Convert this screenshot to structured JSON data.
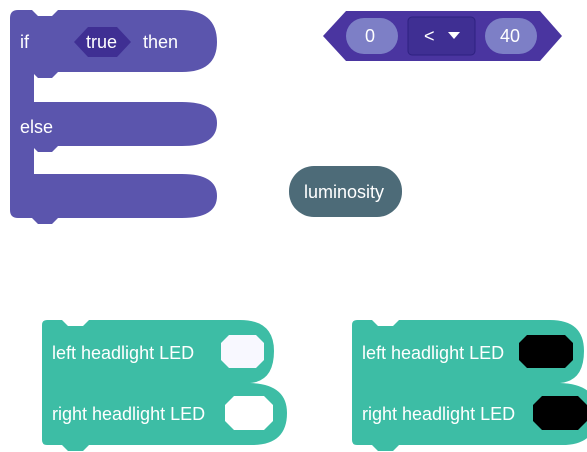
{
  "if_else_block": {
    "if_label": "if",
    "condition_value": "true",
    "then_label": "then",
    "else_label": "else",
    "color": "#5b55ad",
    "condition_color": "#3f2f93"
  },
  "compare_block": {
    "left_value": "0",
    "operator": "<",
    "right_value": "40",
    "color": "#4a35a0",
    "slot_color": "#7d7fc6"
  },
  "sensor_block": {
    "label": "luminosity",
    "color": "#4d6b78"
  },
  "led_block_left": {
    "row1_label": "left headlight LED",
    "row2_label": "right headlight LED",
    "color": "#3dbda5",
    "led_colors": [
      "#f8f8ff",
      "#ffffff"
    ]
  },
  "led_block_right": {
    "row1_label": "left headlight LED",
    "row2_label": "right headlight LED",
    "color": "#3dbda5",
    "led_colors": [
      "#000000",
      "#000000"
    ]
  }
}
